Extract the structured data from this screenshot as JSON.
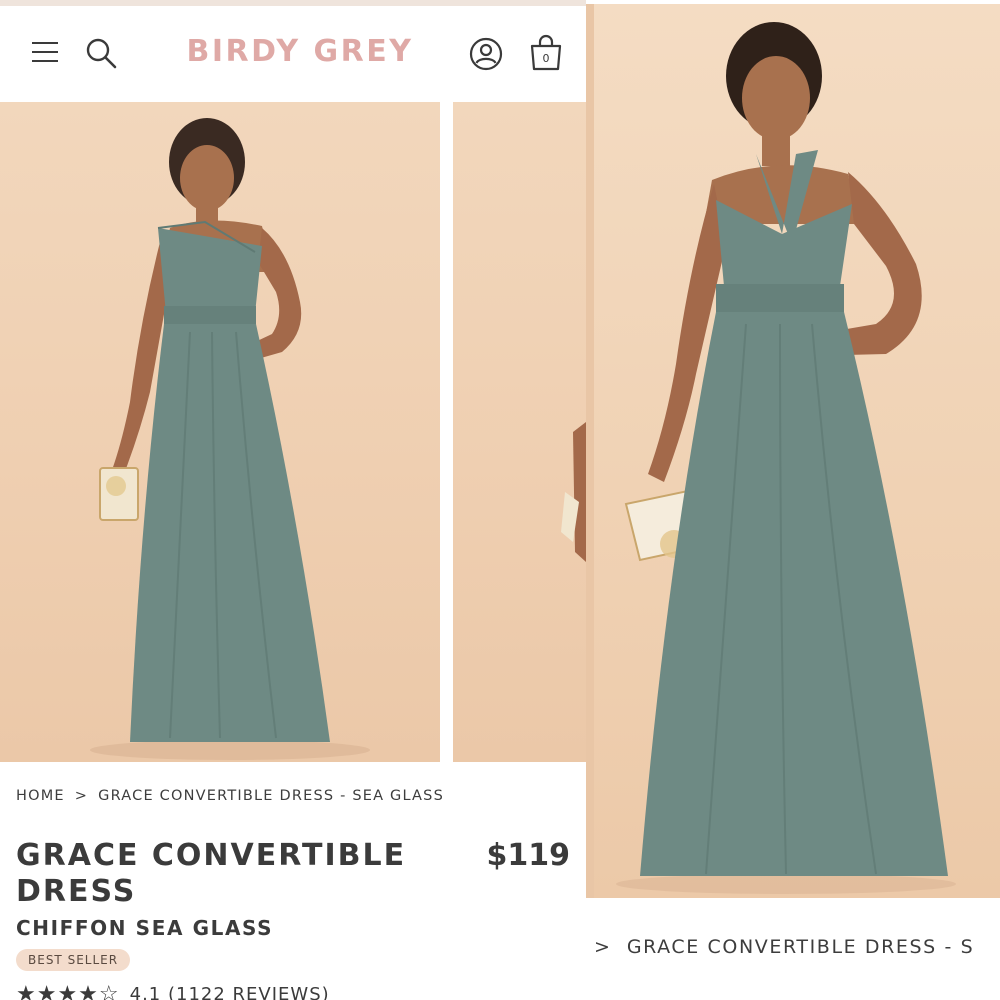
{
  "header": {
    "brand": "BIRDY GREY",
    "bag_count": "0",
    "icons": [
      "menu-icon",
      "search-icon",
      "account-icon",
      "shopping-bag-icon"
    ]
  },
  "gallery": {
    "images": [
      "product-photo-one-shoulder",
      "product-photo-peek",
      "product-photo-halter"
    ]
  },
  "breadcrumb": {
    "home": "HOME",
    "separator": ">",
    "current": "GRACE CONVERTIBLE DRESS - SEA GLASS"
  },
  "product": {
    "title": "GRACE CONVERTIBLE DRESS",
    "price": "$119",
    "variant": "CHIFFON SEA GLASS",
    "badge": "BEST SELLER",
    "rating": {
      "stars": "★★★★☆",
      "value": 4.1,
      "text": "4.1 (1122 REVIEWS)"
    }
  },
  "right_view": {
    "breadcrumb_separator": ">",
    "breadcrumb_text": "GRACE CONVERTIBLE DRESS - S"
  },
  "colors": {
    "brand": "#dfa9a6",
    "dress": "#6e8a84",
    "background": "#f0d2b4",
    "badge": "#f3dccc",
    "text": "#3b3b3b"
  }
}
